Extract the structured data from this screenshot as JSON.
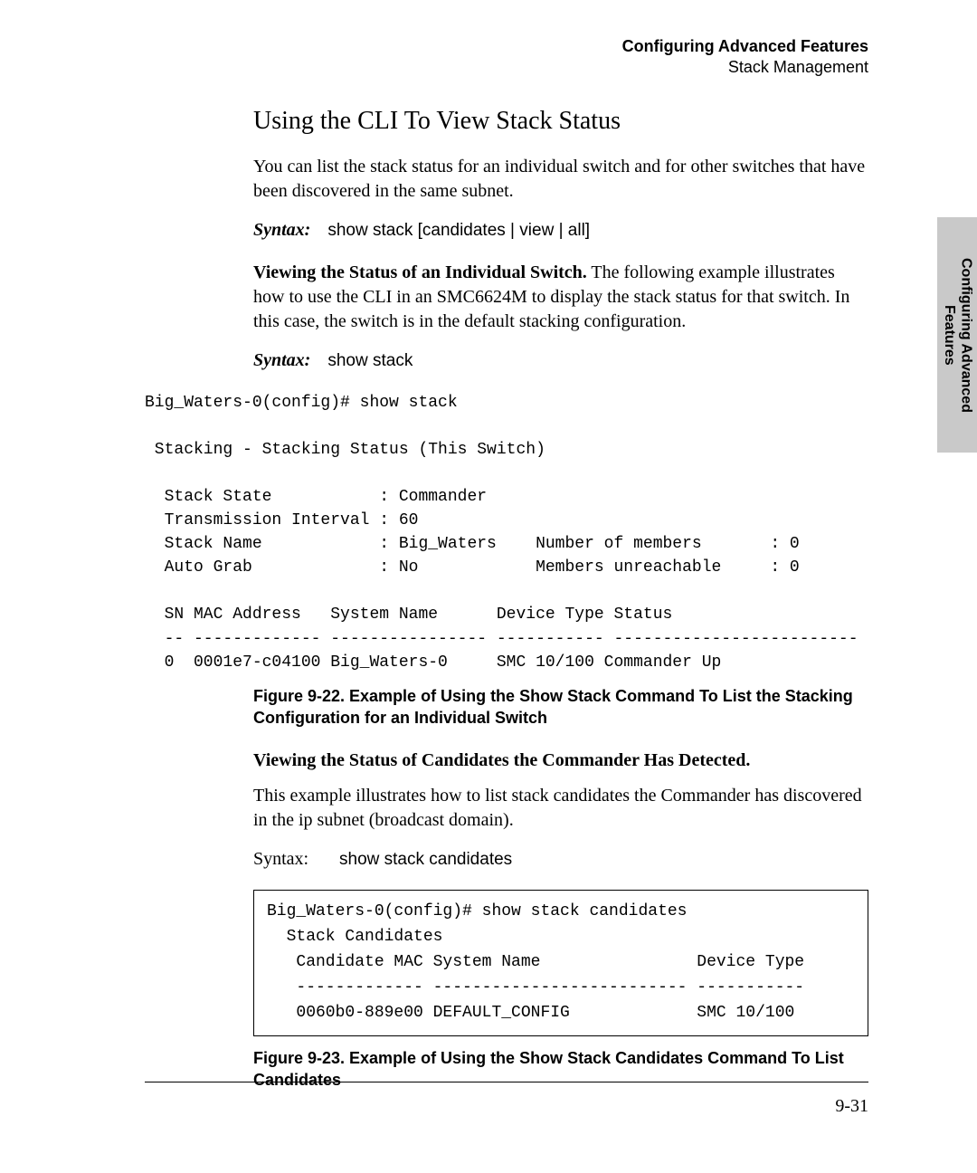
{
  "header": {
    "title_bold": "Configuring Advanced Features",
    "subtitle": "Stack Management"
  },
  "side_tab": {
    "line1": "Configuring Advanced",
    "line2": "Features"
  },
  "section_title": "Using the CLI To View Stack Status",
  "intro": "You can list the stack status for an individual switch and for other switches that have been discovered in the same subnet.",
  "syntax1": {
    "label": "Syntax:",
    "text": "show stack [candidates | view | all]"
  },
  "subsection1": {
    "lead_bold": "Viewing the Status of an Individual Switch.",
    "rest": "  The following example illustrates how to use the CLI in an SMC6624M to display the stack status for that switch. In this case, the switch is in the default stacking configuration."
  },
  "syntax2": {
    "label": "Syntax:",
    "text": "show stack"
  },
  "cli1": "Big_Waters-0(config)# show stack\n\n Stacking - Stacking Status (This Switch)\n\n  Stack State           : Commander\n  Transmission Interval : 60\n  Stack Name            : Big_Waters    Number of members       : 0\n  Auto Grab             : No            Members unreachable     : 0\n\n  SN MAC Address   System Name      Device Type Status\n  -- ------------- ---------------- ----------- -------------------------\n  0  0001e7-c04100 Big_Waters-0     SMC 10/100 Commander Up",
  "figure1": "Figure 9-22.  Example of Using the Show Stack Command To List the Stacking Configuration for an Individual Switch",
  "subsection2_head": "Viewing the Status of Candidates the Commander Has Detected.",
  "subsection2_body": "This example illustrates how to list stack candidates the Commander has discovered in the ip subnet (broadcast domain).",
  "syntax3": {
    "label": "Syntax:",
    "text": "show stack candidates"
  },
  "cli2": "Big_Waters-0(config)# show stack candidates\n  Stack Candidates\n   Candidate MAC System Name                Device Type\n   ------------- -------------------------- -----------\n   0060b0-889e00 DEFAULT_CONFIG             SMC 10/100",
  "figure2": "Figure 9-23.  Example of Using the Show Stack Candidates Command To List Candidates",
  "page_number": "9-31"
}
